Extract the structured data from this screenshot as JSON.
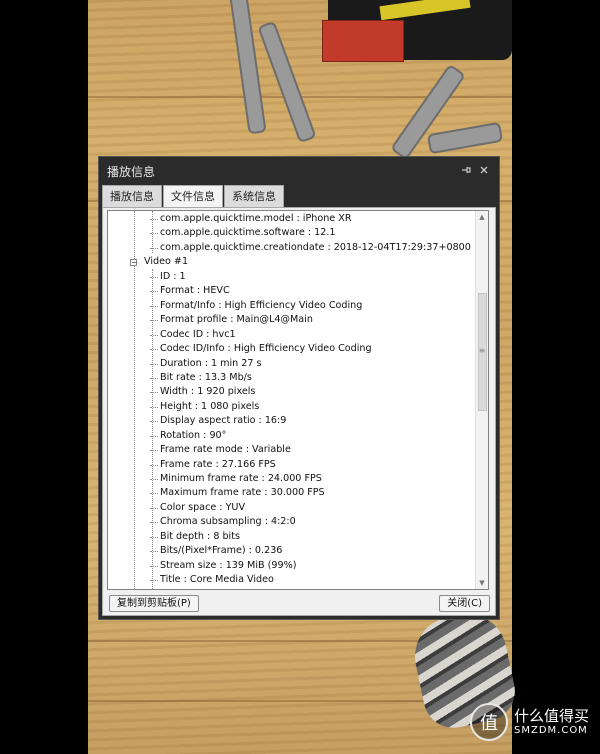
{
  "dialog": {
    "title": "播放信息",
    "pin_icon": "pin-icon",
    "close_icon": "close-icon",
    "tabs": [
      {
        "label": "播放信息",
        "active": false
      },
      {
        "label": "文件信息",
        "active": true
      },
      {
        "label": "系统信息",
        "active": false
      }
    ],
    "tree": {
      "top_rows": [
        "com.apple.quicktime.model : iPhone XR",
        "com.apple.quicktime.software : 12.1",
        "com.apple.quicktime.creationdate : 2018-12-04T17:29:37+0800"
      ],
      "group_label": "Video #1",
      "video_rows": [
        "ID : 1",
        "Format : HEVC",
        "Format/Info : High Efficiency Video Coding",
        "Format profile : Main@L4@Main",
        "Codec ID : hvc1",
        "Codec ID/Info : High Efficiency Video Coding",
        "Duration : 1 min 27 s",
        "Bit rate : 13.3 Mb/s",
        "Width : 1 920 pixels",
        "Height : 1 080 pixels",
        "Display aspect ratio : 16:9",
        "Rotation : 90°",
        "Frame rate mode : Variable",
        "Frame rate : 27.166 FPS",
        "Minimum frame rate : 24.000 FPS",
        "Maximum frame rate : 30.000 FPS",
        "Color space : YUV",
        "Chroma subsampling : 4:2:0",
        "Bit depth : 8 bits",
        "Bits/(Pixel*Frame) : 0.236",
        "Stream size : 139 MiB (99%)",
        "Title : Core Media Video"
      ]
    },
    "copy_button": "复制到剪贴板(P)",
    "close_button": "关闭(C)"
  },
  "watermark": {
    "text_cn": "什么值得买",
    "text_en": "SMZDM.COM",
    "badge_glyph": "值"
  }
}
